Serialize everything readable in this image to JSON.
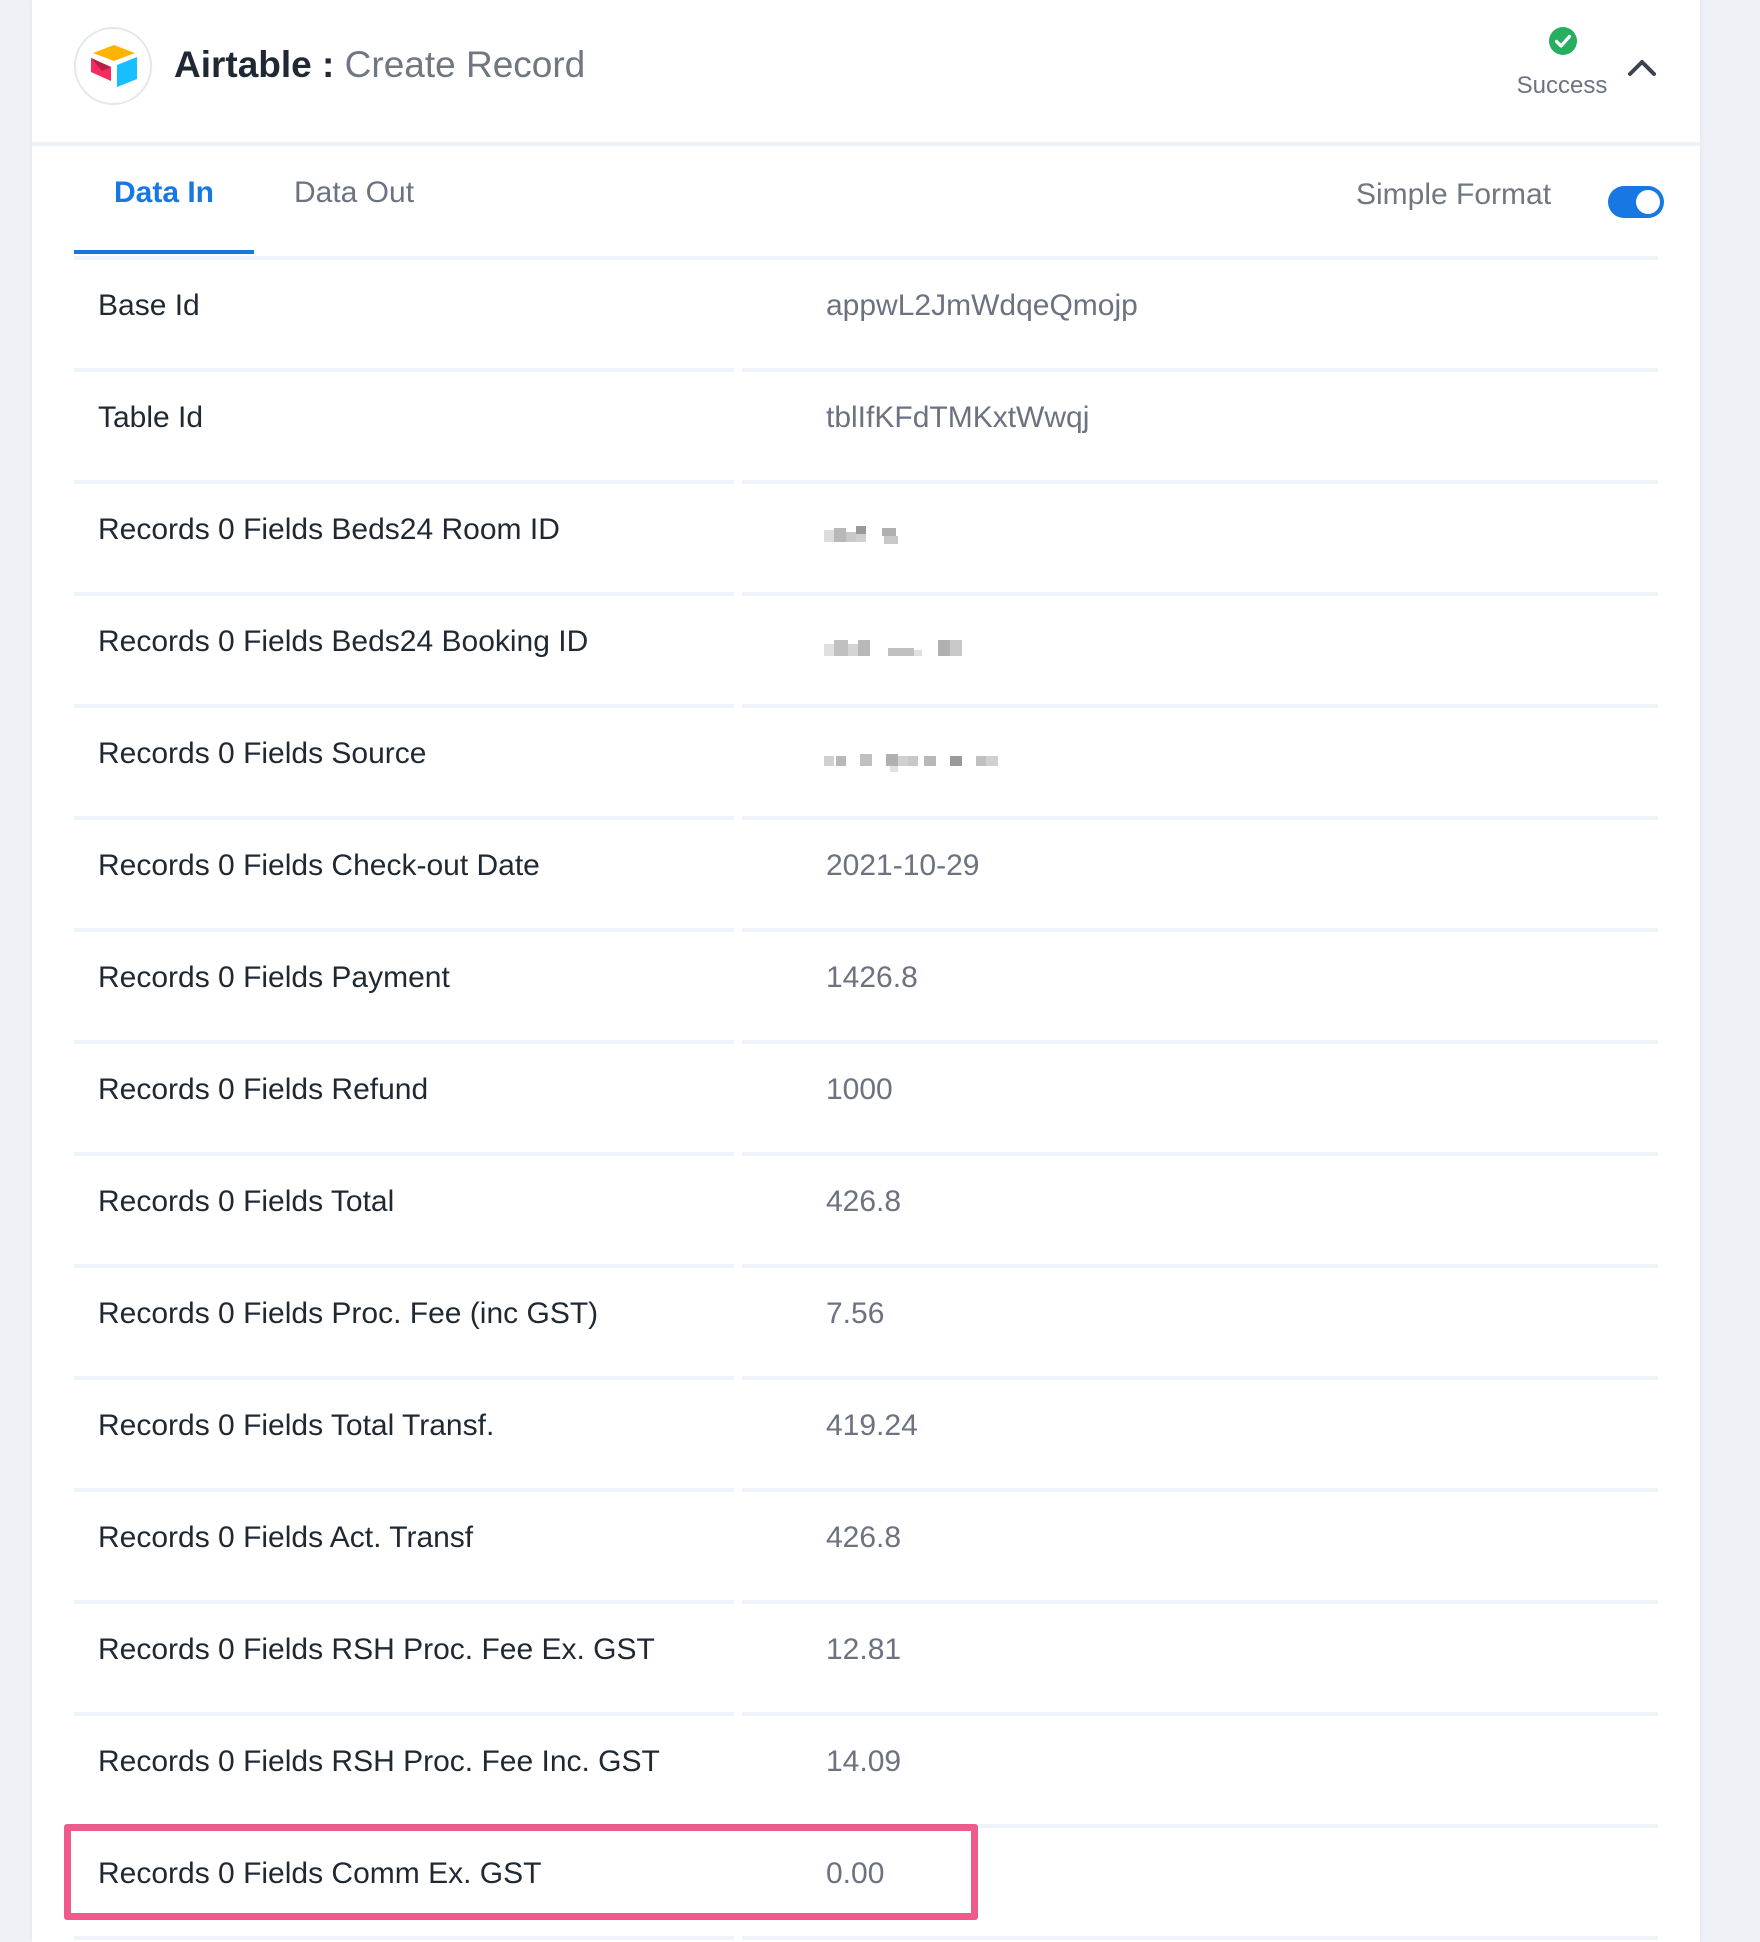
{
  "header": {
    "app_name": "Airtable",
    "separator": " : ",
    "action": "Create Record",
    "status": "Success",
    "status_color": "#27ae60",
    "collapse_icon": "chevron-up-icon"
  },
  "tabs": [
    {
      "label": "Data In",
      "active": true
    },
    {
      "label": "Data Out",
      "active": false
    }
  ],
  "simple_format": {
    "label": "Simple Format",
    "enabled": true
  },
  "colors": {
    "accent": "#1778e3",
    "highlight": "#ee5a8c"
  },
  "rows": [
    {
      "label": "Base Id",
      "value": "appwL2JmWdqeQmojp"
    },
    {
      "label": "Table Id",
      "value": "tblIfKFdTMKxtWwqj"
    },
    {
      "label": "Records 0 Fields Beds24 Room ID",
      "value": null,
      "redacted": true
    },
    {
      "label": "Records 0 Fields Beds24 Booking ID",
      "value": null,
      "redacted": true
    },
    {
      "label": "Records 0 Fields Source",
      "value": null,
      "redacted": true
    },
    {
      "label": "Records 0 Fields Check-out Date",
      "value": "2021-10-29"
    },
    {
      "label": "Records 0 Fields Payment",
      "value": "1426.8"
    },
    {
      "label": "Records 0 Fields Refund",
      "value": "1000"
    },
    {
      "label": "Records 0 Fields Total",
      "value": "426.8"
    },
    {
      "label": "Records 0 Fields Proc. Fee (inc GST)",
      "value": "7.56"
    },
    {
      "label": "Records 0 Fields Total Transf.",
      "value": "419.24"
    },
    {
      "label": "Records 0 Fields Act. Transf",
      "value": "426.8"
    },
    {
      "label": "Records 0 Fields RSH Proc. Fee Ex. GST",
      "value": "12.81"
    },
    {
      "label": "Records 0 Fields RSH Proc. Fee Inc. GST",
      "value": "14.09"
    },
    {
      "label": "Records 0 Fields Comm Ex. GST",
      "value": "0.00",
      "highlighted": true
    }
  ]
}
